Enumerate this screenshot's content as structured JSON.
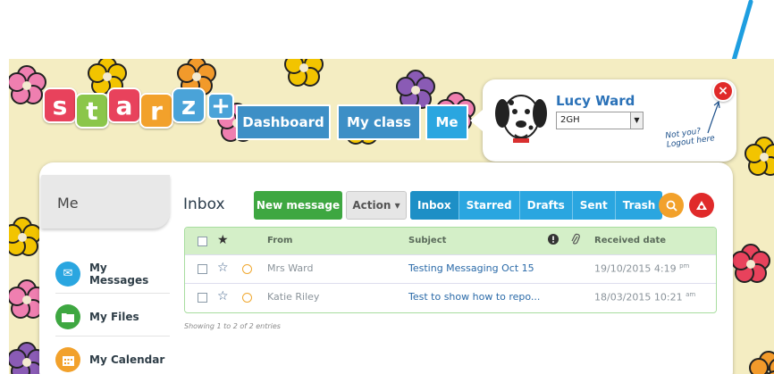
{
  "logo": {
    "letters": [
      {
        "char": "s",
        "color": "#e8425c"
      },
      {
        "char": "t",
        "color": "#8bc64a"
      },
      {
        "char": "a",
        "color": "#e8425c"
      },
      {
        "char": "r",
        "color": "#f2a12b"
      },
      {
        "char": "z",
        "color": "#4aa3d8"
      }
    ],
    "plus": "+"
  },
  "topnav": {
    "items": [
      {
        "label": "Dashboard",
        "active": false
      },
      {
        "label": "My class",
        "active": false
      },
      {
        "label": "Me",
        "active": true
      }
    ]
  },
  "user": {
    "name": "Lucy Ward",
    "class_selected": "2GH",
    "logout_line1": "Not you?",
    "logout_line2": "Logout here",
    "close_glyph": "×"
  },
  "sidebar": {
    "heading": "Me",
    "items": [
      {
        "label": "My Messages",
        "icon": "envelope-icon",
        "color": "#2aa6e0",
        "glyph": "✉"
      },
      {
        "label": "My Files",
        "icon": "folder-icon",
        "color": "#3ea741",
        "glyph": "▰"
      },
      {
        "label": "My Calendar",
        "icon": "calendar-icon",
        "color": "#f2a12b",
        "glyph": "▦"
      }
    ]
  },
  "inbox": {
    "title": "Inbox",
    "new_message_label": "New message",
    "action_label": "Action ▾",
    "folders": [
      {
        "label": "Inbox",
        "active": true
      },
      {
        "label": "Starred",
        "active": false
      },
      {
        "label": "Drafts",
        "active": false
      },
      {
        "label": "Sent",
        "active": false
      },
      {
        "label": "Trash",
        "active": false
      }
    ],
    "search_glyph": "⌕",
    "columns": {
      "from": "From",
      "subject": "Subject",
      "received": "Received date"
    },
    "rows": [
      {
        "from": "Mrs Ward",
        "subject": "Testing Messaging Oct 15",
        "date": "19/10/2015 4:19",
        "ampm": "pm"
      },
      {
        "from": "Katie Riley",
        "subject": "Test to show how to repo...",
        "date": "18/03/2015 10:21",
        "ampm": "am"
      }
    ],
    "footer": "Showing 1 to 2 of 2 entries"
  },
  "colors": {
    "accent_blue": "#3d8fc6",
    "green": "#3ea741",
    "orange": "#f2a12b",
    "red": "#e02a2a"
  }
}
